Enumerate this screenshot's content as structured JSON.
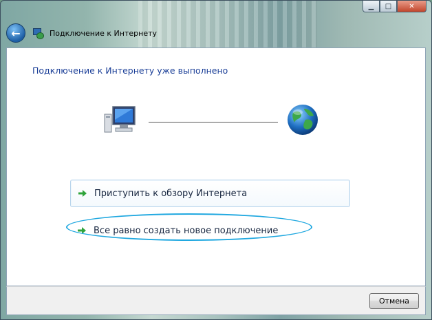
{
  "window": {
    "title": "Подключение к Интернету",
    "controls": {
      "minimize_icon": "minimize-icon",
      "maximize_icon": "maximize-icon",
      "close_icon": "close-icon"
    }
  },
  "toolbar": {
    "back_icon": "back-arrow-icon",
    "app_icon": "network-connection-icon"
  },
  "main": {
    "heading": "Подключение к Интернету уже выполнено",
    "diagram": {
      "left_icon": "computer-icon",
      "right_icon": "globe-icon"
    },
    "options": [
      {
        "label": "Приступить к обзору Интернета",
        "icon": "green-arrow-icon"
      },
      {
        "label": "Все равно создать новое подключение",
        "icon": "green-arrow-icon"
      }
    ]
  },
  "footer": {
    "cancel_label": "Отмена"
  },
  "colors": {
    "heading": "#1a3e97",
    "arrow": "#2fa33a",
    "highlight": "#20a8e0"
  }
}
